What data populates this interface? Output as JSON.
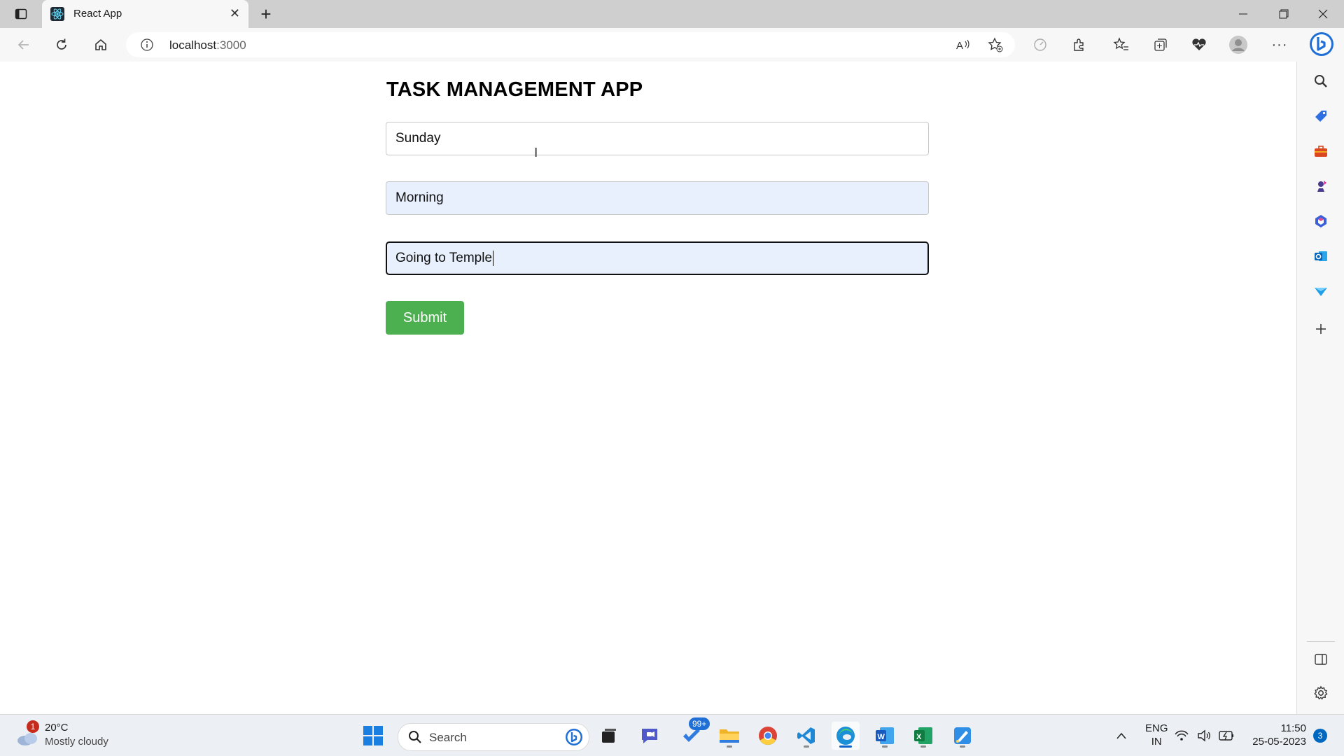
{
  "browser": {
    "tab_title": "React App",
    "new_tab_label": "+",
    "url_host": "localhost",
    "url_port": ":3000"
  },
  "page": {
    "title": "TASK MANAGEMENT APP",
    "fields": {
      "day": "Sunday",
      "time": "Morning",
      "task": "Going to Temple"
    },
    "submit_label": "Submit"
  },
  "taskbar": {
    "weather_temp": "20°C",
    "weather_condition": "Mostly cloudy",
    "weather_badge": "1",
    "search_label": "Search",
    "todo_badge": "99+",
    "lang_line1": "ENG",
    "lang_line2": "IN",
    "time": "11:50",
    "date": "25-05-2023",
    "notifications": "3"
  },
  "colors": {
    "submit_bg": "#4caf50",
    "autofill_bg": "#e8f0fe",
    "accent": "#0a62c9"
  }
}
